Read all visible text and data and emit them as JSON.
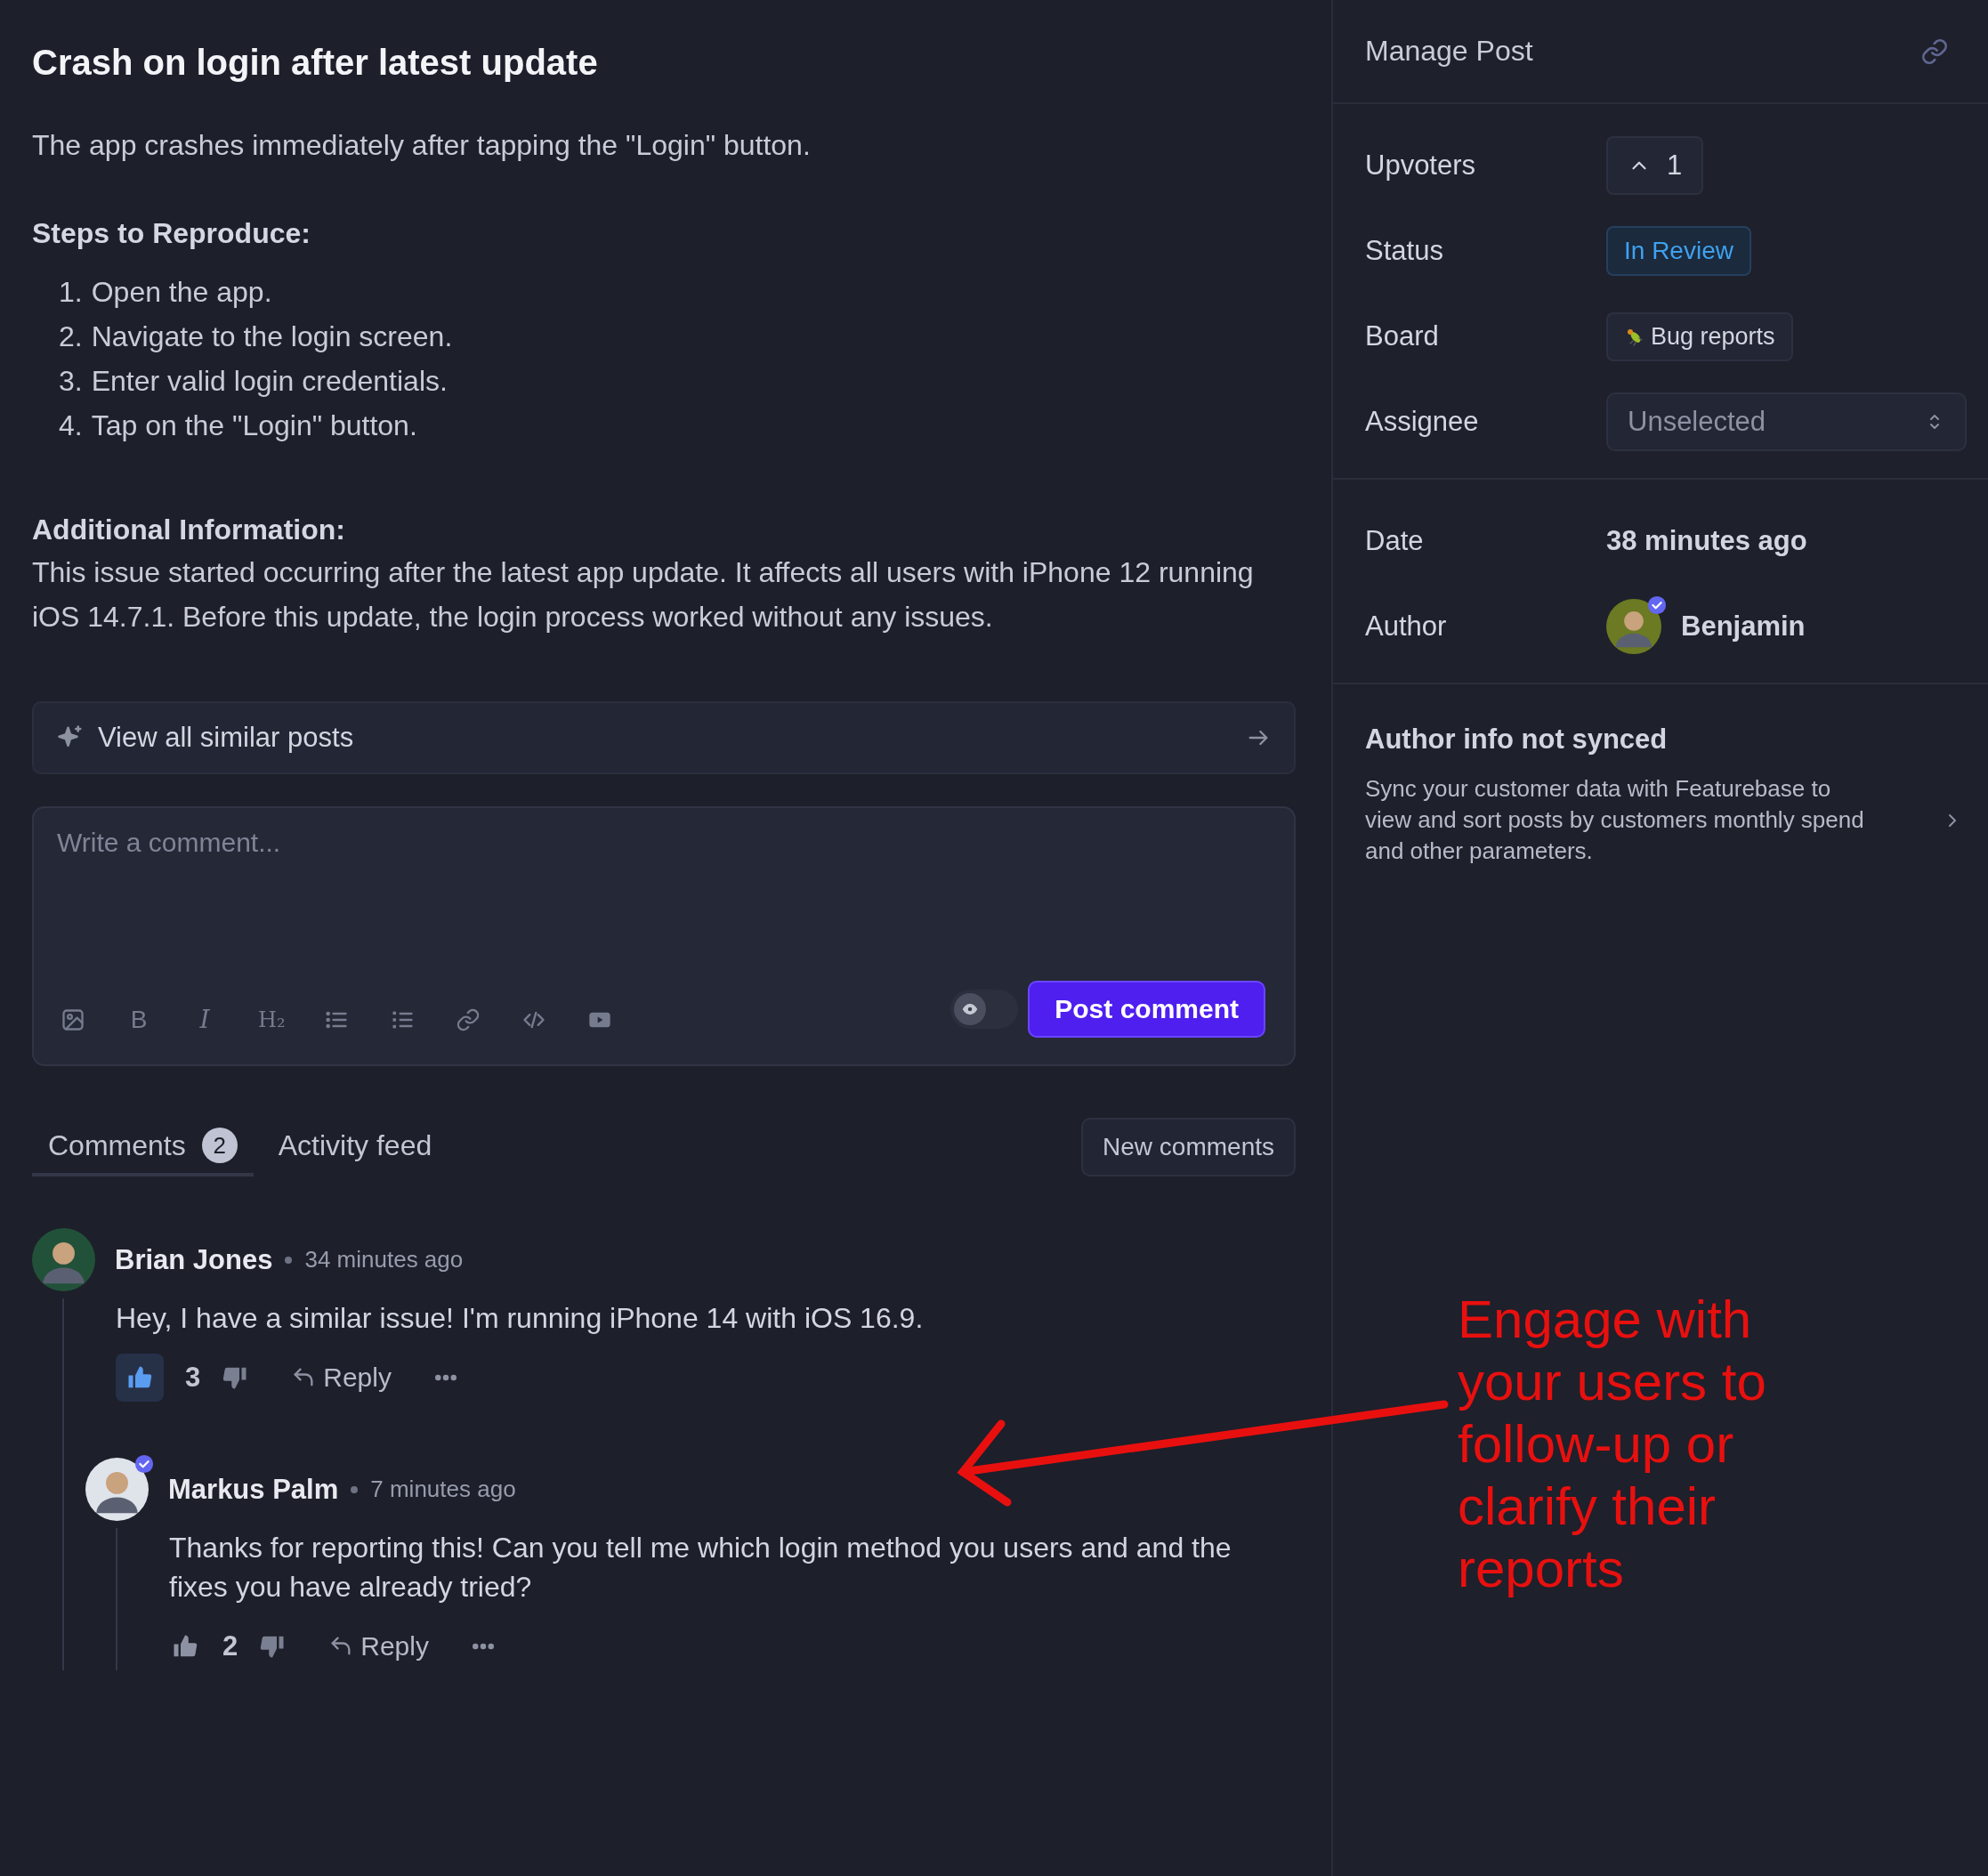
{
  "post": {
    "title": "Crash on login after latest update",
    "intro": "The app crashes immediately after tapping the \"Login\" button.",
    "steps_heading": "Steps to Reproduce:",
    "steps": [
      {
        "number": "1.",
        "text": "Open the app."
      },
      {
        "number": "2.",
        "text": "Navigate to the login screen."
      },
      {
        "number": "3.",
        "text": "Enter valid login credentials."
      },
      {
        "number": "4.",
        "text": "Tap on the \"Login\" button."
      }
    ],
    "info_heading": "Additional Information:",
    "info": "This issue started occurring after the latest app update. It affects all users with iPhone 12 running iOS 14.7.1. Before this update, the login process worked without any issues."
  },
  "similar_posts": {
    "label": "View all similar posts"
  },
  "editor": {
    "placeholder": "Write a comment...",
    "toolbar": [
      {
        "kind": "image"
      },
      {
        "kind": "bold",
        "glyph": "B"
      },
      {
        "kind": "italic",
        "glyph": "I"
      },
      {
        "kind": "heading",
        "glyph": "H₂"
      },
      {
        "kind": "bullets"
      },
      {
        "kind": "numbers"
      },
      {
        "kind": "link"
      },
      {
        "kind": "code"
      },
      {
        "kind": "video"
      }
    ],
    "private_toggle": {
      "on": false
    },
    "submit": "Post comment"
  },
  "tabs": [
    {
      "label": "Comments",
      "count": "2",
      "selected": true
    },
    {
      "label": "Activity feed",
      "selected": false
    }
  ],
  "new_comments_button": "New comments",
  "comments": [
    {
      "author": "Brian Jones",
      "time": "34 minutes ago",
      "verified": false,
      "text": "Hey, I have a similar issue! I'm running iPhone 14 with iOS 16.9.",
      "likes": "3",
      "liked": true,
      "reply": "Reply",
      "replies": [
        {
          "author": "Markus Palm",
          "time": "7 minutes ago",
          "verified": true,
          "text": "Thanks for reporting this! Can you tell me which login method you users and and the fixes you have already tried?",
          "likes": "2",
          "liked": false,
          "reply": "Reply"
        }
      ]
    }
  ],
  "manage": {
    "title": "Manage Post",
    "fields": [
      {
        "kind": "upvotes",
        "label": "Upvoters",
        "value": "1"
      },
      {
        "kind": "status",
        "label": "Status",
        "value": "In Review"
      },
      {
        "kind": "board",
        "label": "Board",
        "value": "Bug reports"
      },
      {
        "kind": "select",
        "label": "Assignee",
        "value": "Unselected"
      }
    ],
    "meta": [
      {
        "kind": "text",
        "label": "Date",
        "value": "38 minutes ago"
      },
      {
        "kind": "user",
        "label": "Author",
        "value": "Benjamin",
        "verified": true
      }
    ],
    "sync": {
      "title": "Author info not synced",
      "text": "Sync your customer data with Featurebase to view and sort posts by customers monthly spend and other parameters."
    }
  },
  "annotation": {
    "text": "Engage with your users to follow-up or clarify their reports"
  }
}
